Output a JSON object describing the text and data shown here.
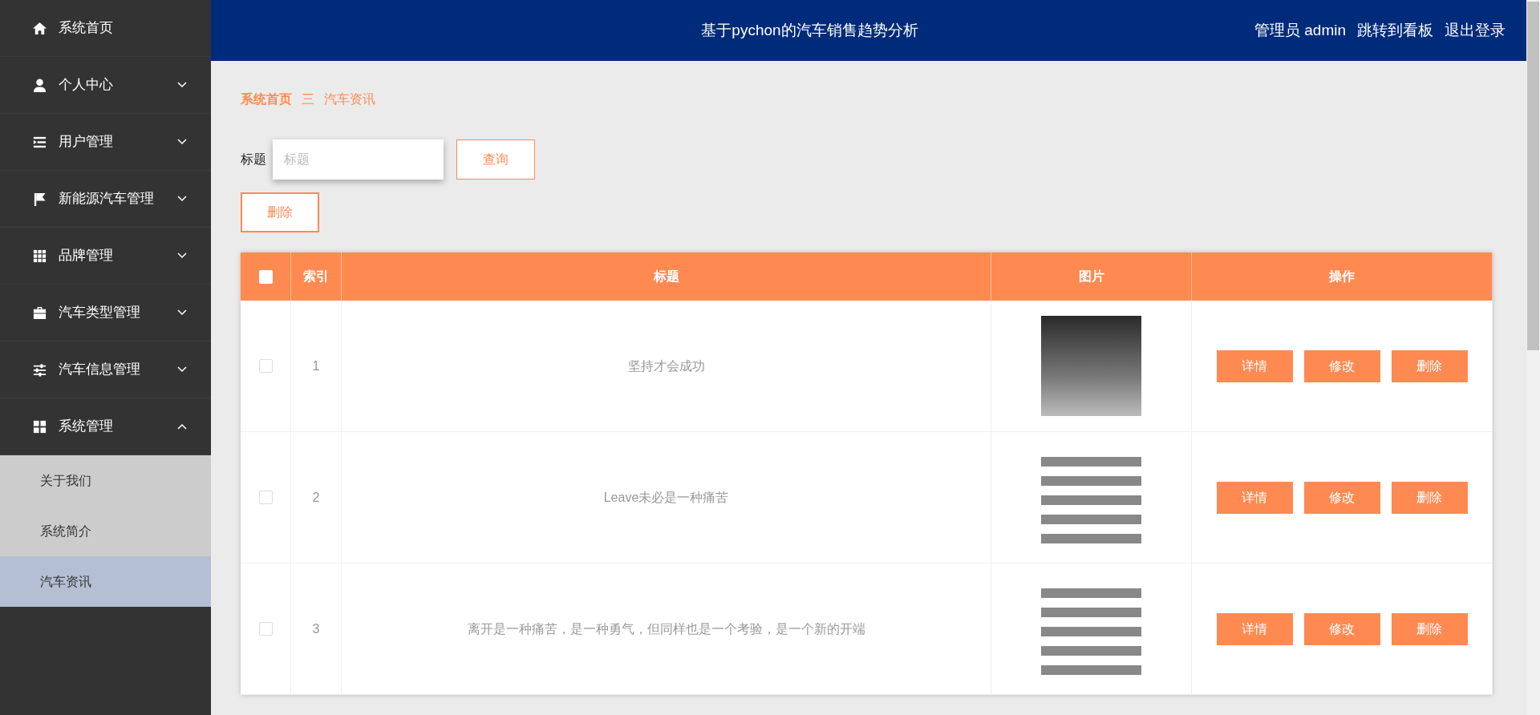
{
  "header": {
    "title": "基于pychon的汽车销售趋势分析",
    "user": "管理员 admin",
    "links": [
      "跳转到看板",
      "退出登录"
    ]
  },
  "sidebar": {
    "items": [
      {
        "label": "系统首页"
      },
      {
        "label": "个人中心",
        "expanded": false
      },
      {
        "label": "用户管理",
        "expanded": false
      },
      {
        "label": "新能源汽车管理",
        "expanded": false
      },
      {
        "label": "品牌管理",
        "expanded": false
      },
      {
        "label": "汽车类型管理",
        "expanded": false
      },
      {
        "label": "汽车信息管理",
        "expanded": false
      },
      {
        "label": "系统管理",
        "expanded": true,
        "children": [
          {
            "label": "关于我们",
            "selected": false
          },
          {
            "label": "系统简介",
            "selected": false
          },
          {
            "label": "汽车资讯",
            "selected": true
          }
        ]
      }
    ]
  },
  "breadcrumb": {
    "items": [
      "系统首页",
      "汽车资讯"
    ],
    "separator": "三"
  },
  "search": {
    "label": "标题",
    "placeholder": "标题",
    "button": "查询"
  },
  "delete_button": "删除",
  "table": {
    "columns": [
      "索引",
      "标题",
      "图片",
      "操作"
    ],
    "header_checked": false,
    "rows": [
      {
        "checked": false,
        "index": "1",
        "title": "坚持才会成功",
        "kind": "photo",
        "actions": [
          "详情",
          "修改",
          "删除"
        ]
      },
      {
        "checked": false,
        "index": "2",
        "title": "Leave未必是一种痛苦",
        "kind": "illustration",
        "actions": [
          "详情",
          "修改",
          "删除"
        ]
      },
      {
        "checked": false,
        "index": "3",
        "title": "离开是一种痛苦，是一种勇气，但同样也是一个考验，是一个新的开端",
        "kind": "illustration",
        "actions": [
          "详情",
          "修改",
          "删除"
        ]
      }
    ]
  }
}
